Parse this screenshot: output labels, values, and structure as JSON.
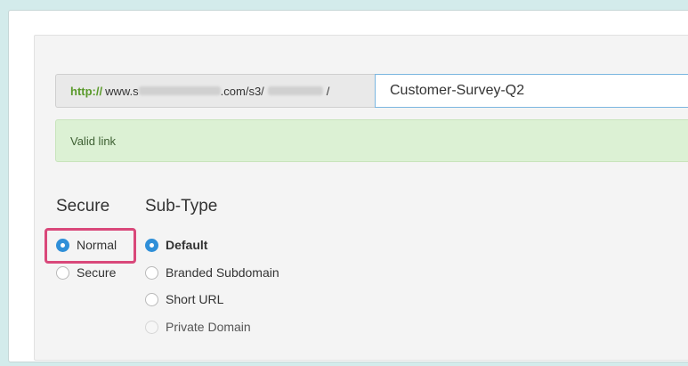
{
  "url": {
    "protocol": "http://",
    "domain_prefix": "www.s",
    "domain_suffix": ".com/s3/",
    "trailing_slash": "/",
    "slug_value": "Customer-Survey-Q2"
  },
  "validation": {
    "message": "Valid link"
  },
  "secure": {
    "heading": "Secure",
    "options": [
      {
        "label": "Normal",
        "checked": true
      },
      {
        "label": "Secure",
        "checked": false
      }
    ]
  },
  "subtype": {
    "heading": "Sub-Type",
    "options": [
      {
        "label": "Default",
        "checked": true
      },
      {
        "label": "Branded Subdomain",
        "checked": false
      },
      {
        "label": "Short URL",
        "checked": false
      },
      {
        "label": "Private Domain",
        "checked": false,
        "disabled": true
      }
    ]
  },
  "colors": {
    "accent": "#2f8fd8",
    "highlight": "#d9487a",
    "valid_bg": "#dcf1d4",
    "protocol": "#5a9a2b"
  }
}
